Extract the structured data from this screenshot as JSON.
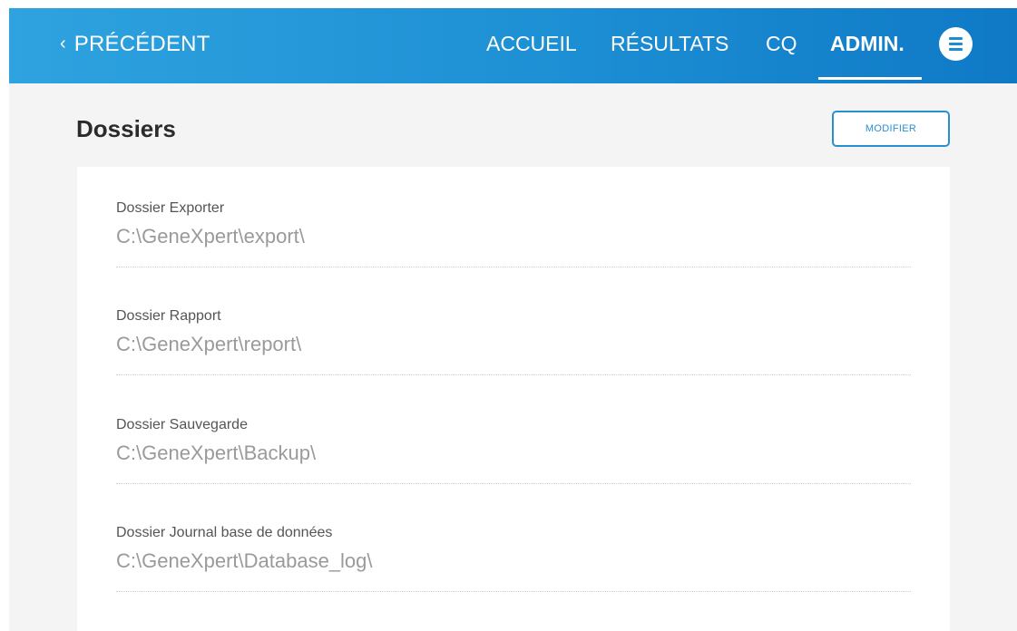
{
  "header": {
    "back_label": "PRÉCÉDENT",
    "back_chevron": "‹",
    "nav": [
      {
        "label": "ACCUEIL",
        "active": false
      },
      {
        "label": "RÉSULTATS",
        "active": false
      },
      {
        "label": "CQ",
        "active": false
      },
      {
        "label": "ADMIN.",
        "active": true
      }
    ],
    "menu_icon": "hamburger-menu-icon",
    "colors": {
      "bar_start": "#2ea3df",
      "bar_end": "#0f79c6",
      "text": "#ffffff"
    }
  },
  "page": {
    "title": "Dossiers",
    "modify_button": "MODIFIER",
    "accent_color": "#2a8fd0"
  },
  "folders": [
    {
      "label": "Dossier Exporter",
      "value": "C:\\GeneXpert\\export\\"
    },
    {
      "label": "Dossier Rapport",
      "value": "C:\\GeneXpert\\report\\"
    },
    {
      "label": "Dossier Sauvegarde",
      "value": "C:\\GeneXpert\\Backup\\"
    },
    {
      "label": "Dossier Journal base de données",
      "value": "C:\\GeneXpert\\Database_log\\"
    }
  ]
}
